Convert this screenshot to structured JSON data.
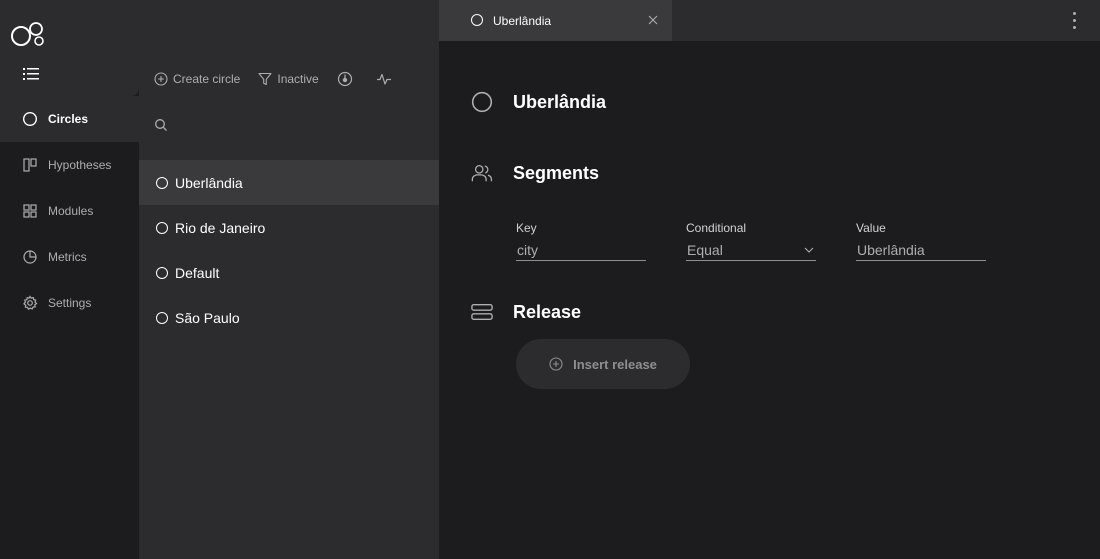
{
  "nav": {
    "items": [
      {
        "label": "Circles",
        "icon": "circle-icon",
        "active": true
      },
      {
        "label": "Hypotheses",
        "icon": "hypotheses-icon",
        "active": false
      },
      {
        "label": "Modules",
        "icon": "modules-icon",
        "active": false
      },
      {
        "label": "Metrics",
        "icon": "metrics-icon",
        "active": false
      },
      {
        "label": "Settings",
        "icon": "settings-icon",
        "active": false
      }
    ]
  },
  "toolbar": {
    "create_label": "Create circle",
    "inactive_label": "Inactive"
  },
  "search": {
    "placeholder": "",
    "value": ""
  },
  "circles": [
    {
      "name": "Uberlândia",
      "selected": true
    },
    {
      "name": "Rio de Janeiro",
      "selected": false
    },
    {
      "name": "Default",
      "selected": false
    },
    {
      "name": "São Paulo",
      "selected": false
    }
  ],
  "tab": {
    "label": "Uberlândia"
  },
  "detail": {
    "title": "Uberlândia",
    "segments_title": "Segments",
    "fields": {
      "key_label": "Key",
      "key_value": "city",
      "conditional_label": "Conditional",
      "conditional_value": "Equal",
      "value_label": "Value",
      "value_value": "Uberlândia"
    },
    "release_title": "Release",
    "insert_release_label": "Insert release"
  },
  "colors": {
    "background": "#1c1c1e",
    "panel": "#2c2c2e",
    "selected": "#3a3a3c",
    "muted_text": "#aeaeb2"
  }
}
